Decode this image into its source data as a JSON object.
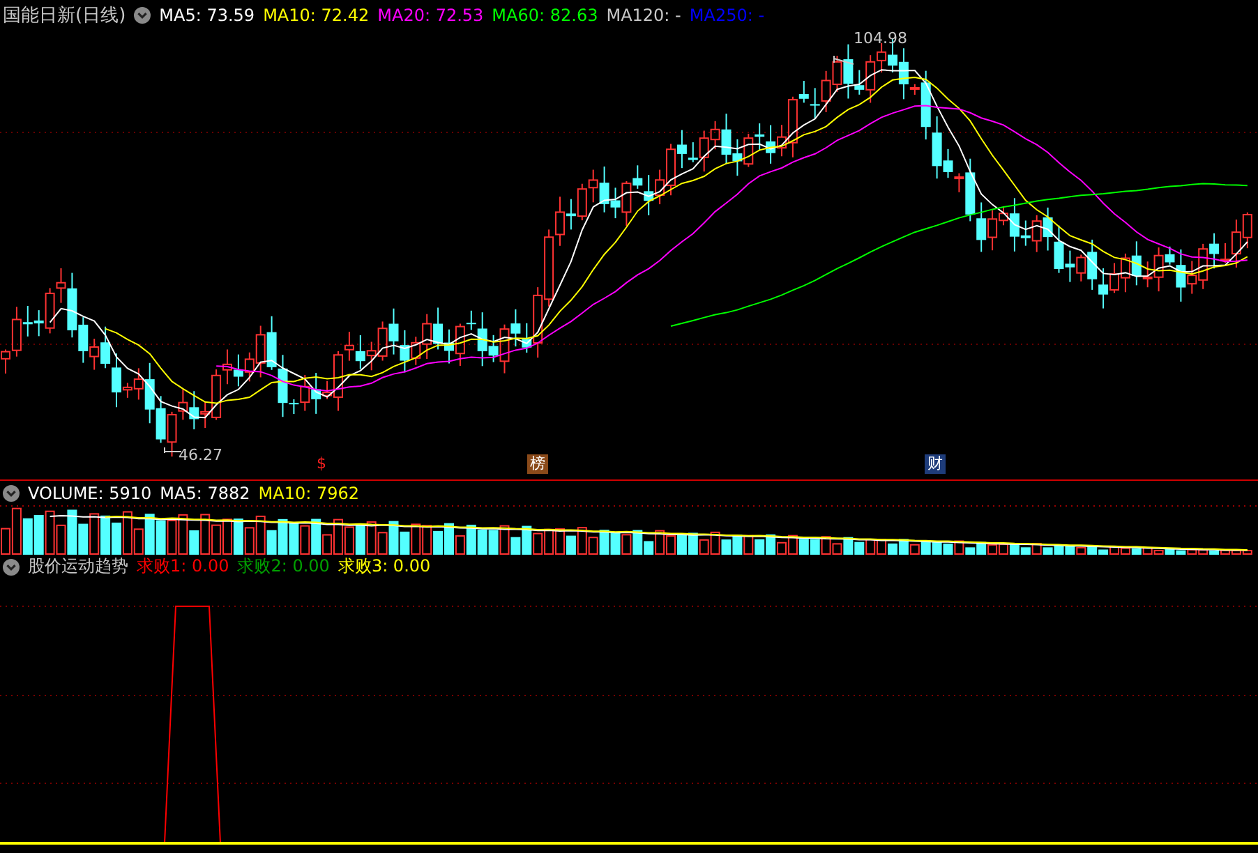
{
  "title": "国能日新(日线)",
  "main_legend": [
    {
      "label": "MA5: 73.59",
      "color": "#ffffff"
    },
    {
      "label": "MA10: 72.42",
      "color": "#ffff00"
    },
    {
      "label": "MA20: 72.53",
      "color": "#ff00ff"
    },
    {
      "label": "MA60: 82.63",
      "color": "#00ff00"
    },
    {
      "label": "MA120: -",
      "color": "#c8c8c8"
    },
    {
      "label": "MA250: -",
      "color": "#0000ff"
    }
  ],
  "price_labels": {
    "high": "104.98",
    "low": "46.27"
  },
  "event_markers": [
    {
      "label": "$",
      "kind": "dollar"
    },
    {
      "label": "榜",
      "kind": "list"
    },
    {
      "label": "财",
      "kind": "finance"
    }
  ],
  "volume_panel": {
    "legend": [
      {
        "label": "VOLUME: 5910",
        "color": "#ffffff"
      },
      {
        "label": "MA5: 7882",
        "color": "#ffffff"
      },
      {
        "label": "MA10: 7962",
        "color": "#ffff00"
      }
    ]
  },
  "indicator_panel": {
    "name": "股价运动趋势",
    "legend": [
      {
        "label": "求败1: 0.00",
        "color": "#ff0000"
      },
      {
        "label": "求败2: 0.00",
        "color": "#00a000"
      },
      {
        "label": "求败3: 0.00",
        "color": "#ffff00"
      }
    ]
  }
}
